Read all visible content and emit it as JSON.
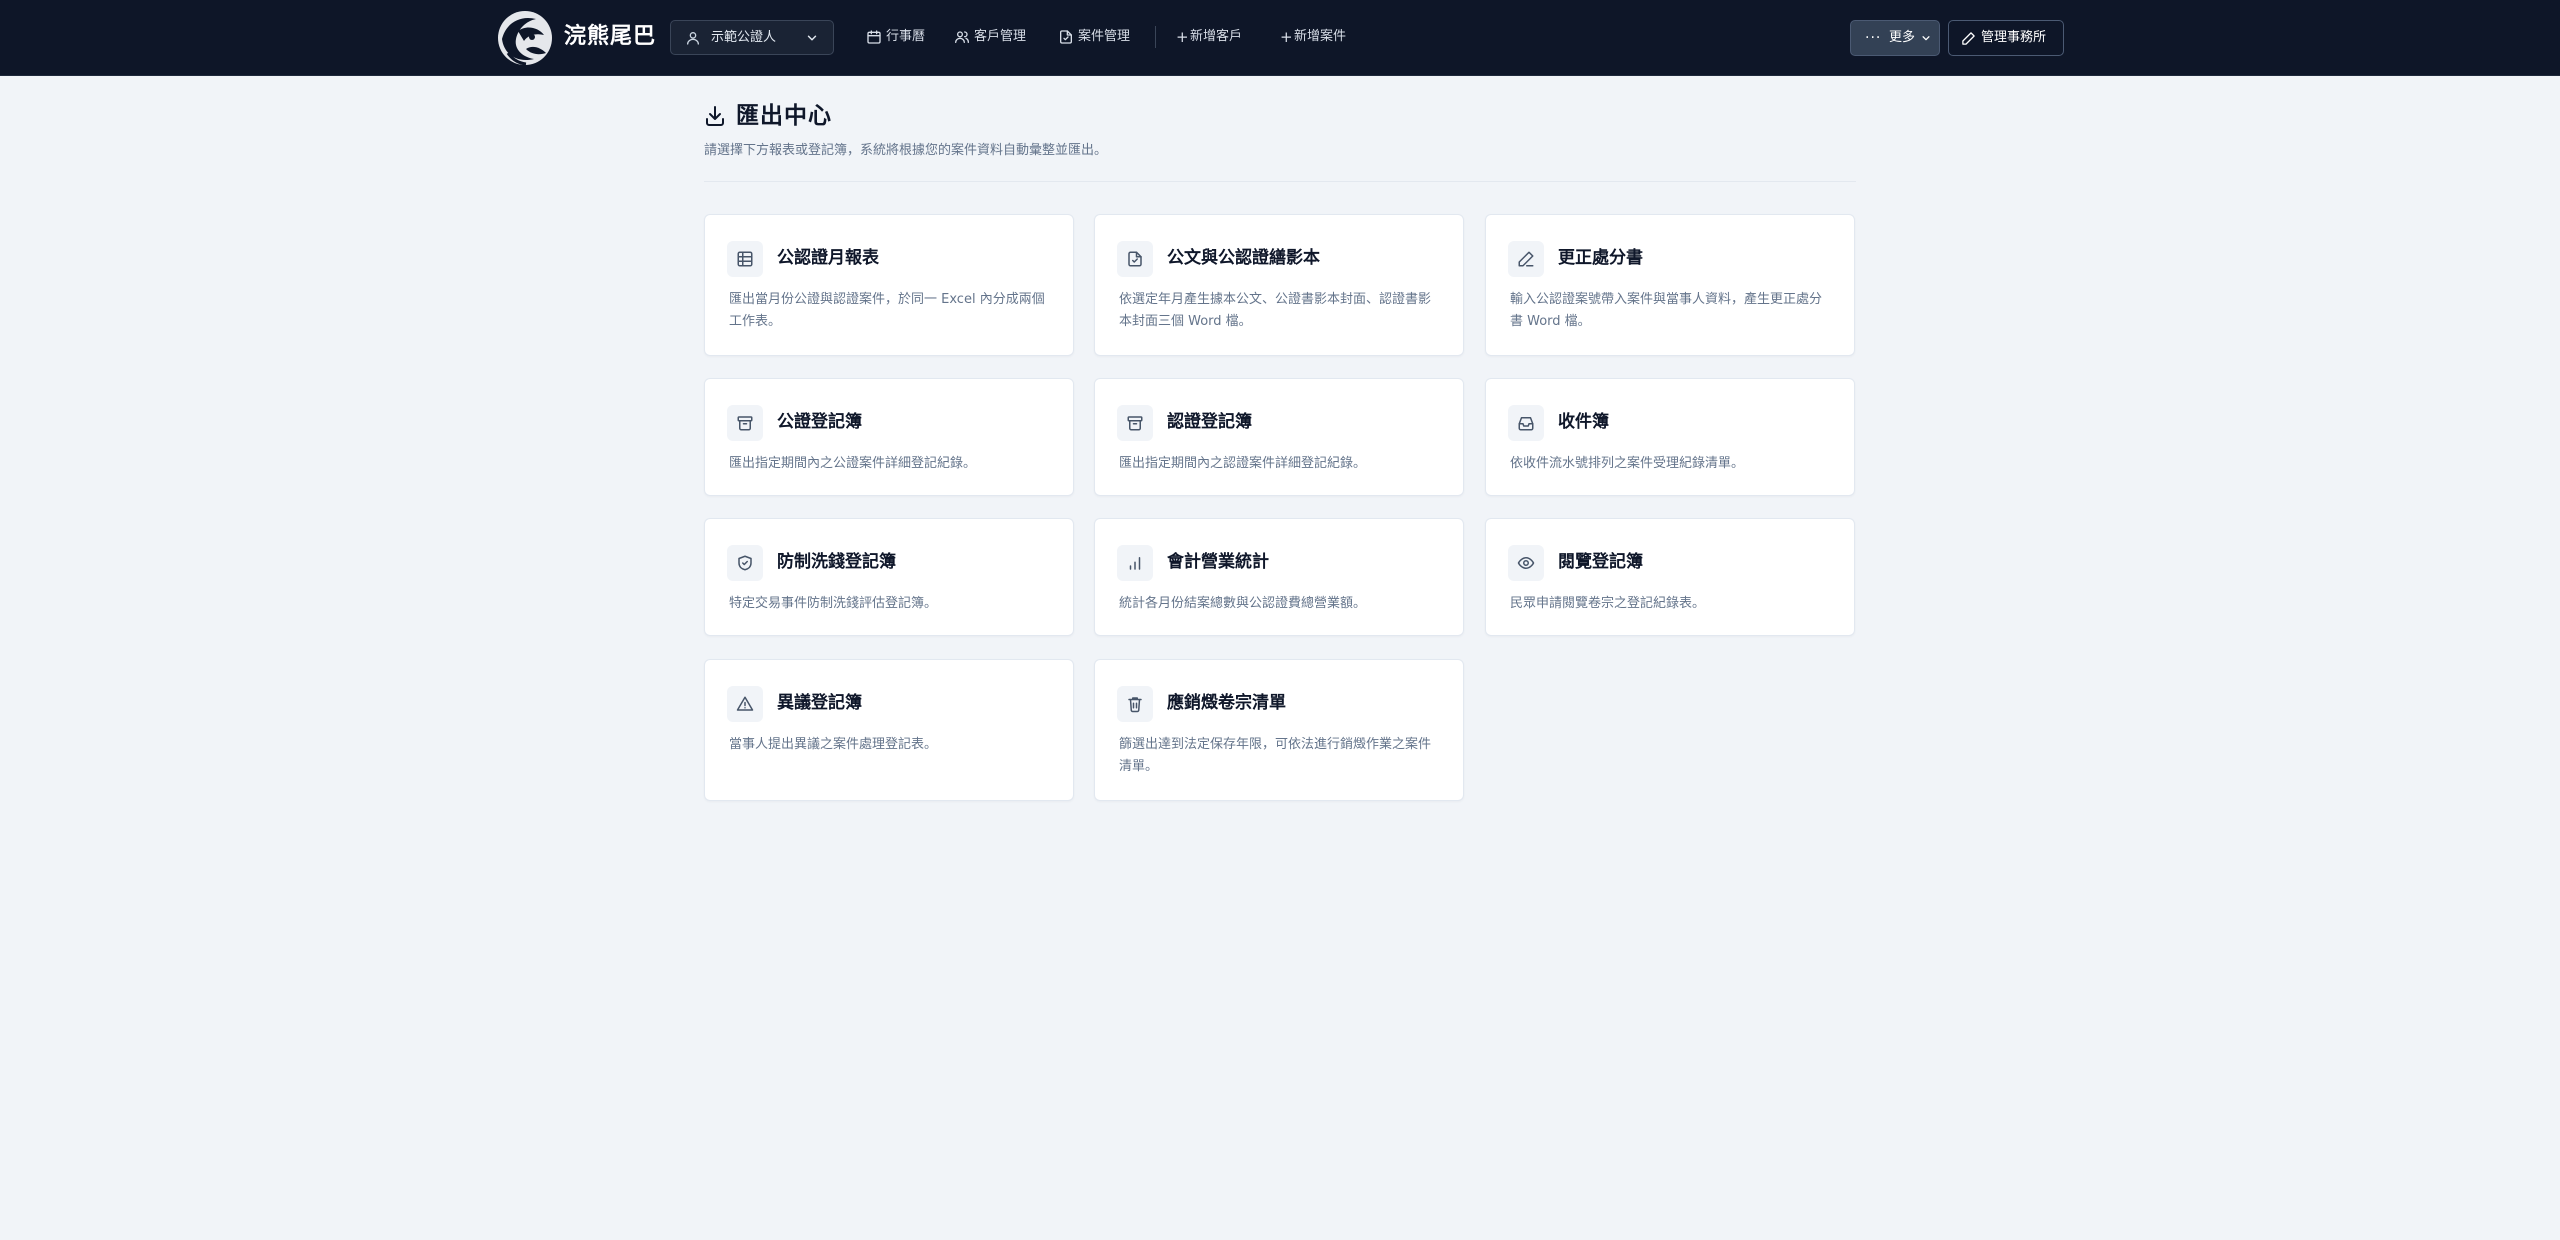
{
  "nav": {
    "brand": "浣熊尾巴",
    "notary_select": "示範公證人",
    "links": [
      {
        "label": "行事曆"
      },
      {
        "label": "客戶管理"
      },
      {
        "label": "案件管理"
      },
      {
        "label": "新增客戶"
      },
      {
        "label": "新增案件"
      }
    ],
    "more_label": "更多",
    "admin_label": "管理事務所"
  },
  "page": {
    "title": "匯出中心",
    "subtitle": "請選擇下方報表或登記簿，系統將根據您的案件資料自動彙整並匯出。"
  },
  "cards": [
    {
      "title": "公認證月報表",
      "desc": "匯出當月份公證與認證案件，於同一 Excel 內分成兩個工作表。",
      "icon": "table-icon"
    },
    {
      "title": "公文與公認證繕影本",
      "desc": "依選定年月產生據本公文、公證書影本封面、認證書影本封面三個 Word 檔。",
      "icon": "file-check-icon"
    },
    {
      "title": "更正處分書",
      "desc": "輸入公認證案號帶入案件與當事人資料，產生更正處分書 Word 檔。",
      "icon": "pencil-icon"
    },
    {
      "title": "公證登記簿",
      "desc": "匯出指定期間內之公證案件詳細登記紀錄。",
      "icon": "archive-icon"
    },
    {
      "title": "認證登記簿",
      "desc": "匯出指定期間內之認證案件詳細登記紀錄。",
      "icon": "archive-icon"
    },
    {
      "title": "收件簿",
      "desc": "依收件流水號排列之案件受理紀錄清單。",
      "icon": "inbox-icon"
    },
    {
      "title": "防制洗錢登記簿",
      "desc": "特定交易事件防制洗錢評估登記簿。",
      "icon": "shield-check-icon"
    },
    {
      "title": "會計營業統計",
      "desc": "統計各月份結案總數與公認證費總營業額。",
      "icon": "bar-chart-icon"
    },
    {
      "title": "閱覽登記簿",
      "desc": "民眾申請閱覽卷宗之登記紀錄表。",
      "icon": "eye-icon"
    },
    {
      "title": "異議登記簿",
      "desc": "當事人提出異議之案件處理登記表。",
      "icon": "alert-triangle-icon"
    },
    {
      "title": "應銷燬卷宗清單",
      "desc": "篩選出達到法定保存年限，可依法進行銷燬作業之案件清單。",
      "icon": "trash-icon"
    }
  ]
}
